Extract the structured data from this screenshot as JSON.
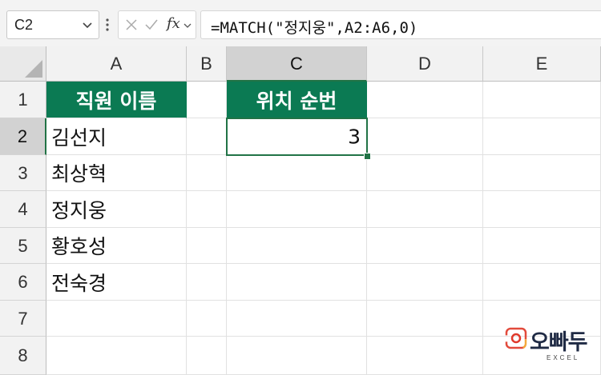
{
  "formula_bar": {
    "name_box": "C2",
    "fx_label": "fx",
    "formula": "=MATCH(\"정지웅\",A2:A6,0)"
  },
  "grid": {
    "columns": [
      "A",
      "B",
      "C",
      "D",
      "E"
    ],
    "rows": [
      "1",
      "2",
      "3",
      "4",
      "5",
      "6",
      "7",
      "8"
    ],
    "selected_column": "C",
    "selected_row": "2",
    "cells": {
      "A1": "직원 이름",
      "C1": "위치 순번",
      "A2": "김선지",
      "A3": "최상혁",
      "A4": "정지웅",
      "A5": "황호성",
      "A6": "전숙경",
      "C2": "3"
    }
  },
  "colors": {
    "header_fill": "#0b7a53",
    "selection": "#217346"
  },
  "logo": {
    "text": "오빠두",
    "subtext": "EXCEL"
  }
}
